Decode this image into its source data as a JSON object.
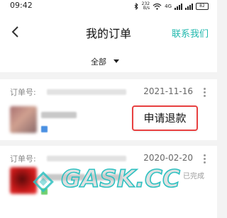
{
  "status_bar": {
    "time": "09:42",
    "network_speed_top": "232",
    "network_speed_bottom": "B/s",
    "network_type": "4G",
    "battery": "82",
    "icons": [
      "bluetooth-icon",
      "wifi-icon",
      "signal-icon",
      "battery-icon"
    ]
  },
  "nav": {
    "back_icon": "chevron-left-icon",
    "title": "我的订单",
    "contact_label": "联系我们",
    "accent_color": "#1fb8ad"
  },
  "filter": {
    "selected": "全部",
    "icon": "caret-down-icon"
  },
  "orders": [
    {
      "order_no_label": "订单号:",
      "date": "2021-11-16",
      "action_label": "申请退款",
      "more_icon": "more-vertical-icon"
    },
    {
      "order_no_label": "订单号:",
      "date": "2020-02-20",
      "status": "已完成",
      "more_icon": "more-vertical-icon"
    }
  ],
  "watermark": {
    "text": "GASK.CC"
  },
  "colors": {
    "highlight_border": "#e84040",
    "background": "#f3f3f3"
  }
}
